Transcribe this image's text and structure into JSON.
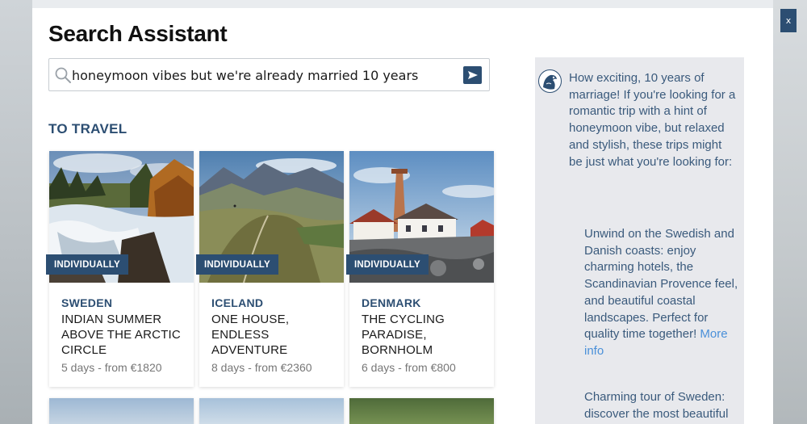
{
  "window": {
    "close_label": "x"
  },
  "header": {
    "title": "Search Assistant"
  },
  "search": {
    "value": "honeymoon vibes but we're already married 10 years",
    "placeholder": ""
  },
  "results": {
    "heading": "TO TRAVEL",
    "cards": [
      {
        "badge": "INDIVIDUALLY",
        "country": "SWEDEN",
        "title": "INDIAN SUMMER ABOVE THE ARCTIC CIRCLE",
        "meta": "5 days - from €1820"
      },
      {
        "badge": "INDIVIDUALLY",
        "country": "ICELAND",
        "title": "ONE HOUSE, ENDLESS ADVENTURE",
        "meta": "8 days - from €2360"
      },
      {
        "badge": "INDIVIDUALLY",
        "country": "DENMARK",
        "title": "THE CYCLING PARADISE, BORNHOLM",
        "meta": "6 days - from €800"
      }
    ]
  },
  "assistant": {
    "intro": "How exciting, 10 years of marriage! If you're looking for a romantic trip with a hint of honeymoon vibe, but relaxed and stylish, these trips might be just what you're looking for:",
    "suggestions": [
      {
        "text": "Unwind on the Swedish and Danish coasts: enjoy charming hotels, the Scandinavian Provence feel, and beautiful coastal landscapes. Perfect for quality time together! ",
        "link": "More info"
      },
      {
        "text": "Charming tour of Sweden: discover the most beautiful",
        "link": ""
      }
    ]
  },
  "colors": {
    "accent": "#2c4e72",
    "panel_bg": "#e8e9ed",
    "assistant_text": "#3a5a7c",
    "link": "#4a90d9"
  }
}
